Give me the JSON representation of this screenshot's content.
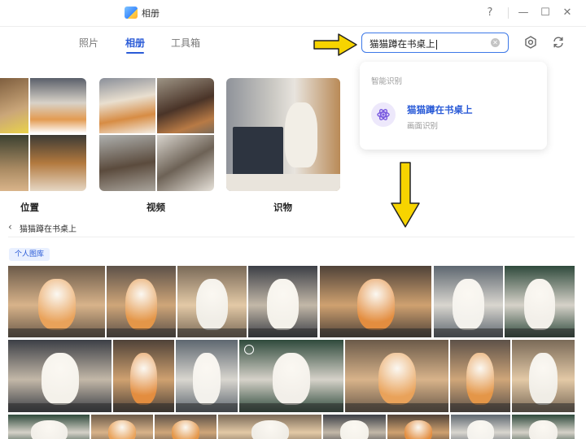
{
  "app": {
    "title": "相册"
  },
  "window_controls": {
    "help": "?",
    "minimize": "—",
    "maximize": "☐",
    "close": "✕"
  },
  "tabs": [
    {
      "label": "照片",
      "active": false
    },
    {
      "label": "相册",
      "active": true
    },
    {
      "label": "工具箱",
      "active": false
    }
  ],
  "search": {
    "value": "猫猫蹲在书桌上",
    "clear_icon": "clear-icon"
  },
  "toolbar_icons": [
    "settings-icon",
    "refresh-icon"
  ],
  "dropdown": {
    "section_label": "智能识别",
    "result_title": "猫猫蹲在书桌上",
    "result_subtitle": "画面识别",
    "result_icon": "ai-recognition-icon"
  },
  "albums": [
    {
      "label": "位置"
    },
    {
      "label": "视频"
    },
    {
      "label": "识物"
    }
  ],
  "breadcrumb": {
    "back_icon": "chevron-left-icon",
    "text": "猫猫蹲在书桌上"
  },
  "library_badge": "个人图库",
  "colors": {
    "accent": "#2a5bd7",
    "arrow": "#f7d400"
  }
}
